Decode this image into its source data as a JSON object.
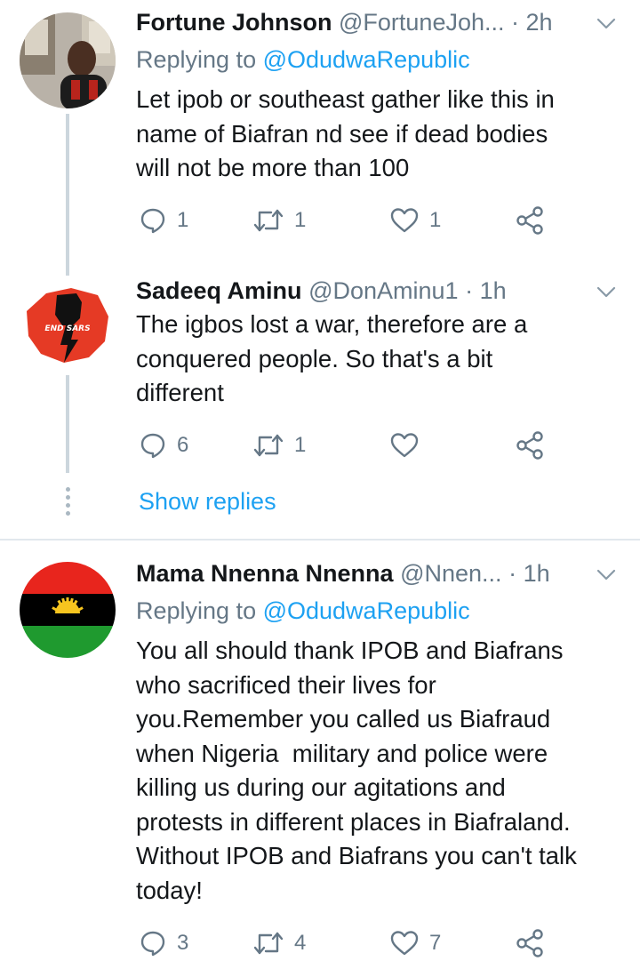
{
  "tweets": [
    {
      "name": "Fortune Johnson",
      "handle": "@FortuneJoh...",
      "dot": "·",
      "time": "2h",
      "replying_prefix": "Replying to ",
      "replying_to": "@OdudwaRepublic",
      "text": "Let ipob or southeast gather like this in\nname of Biafran nd see if dead bodies\nwill not be more than 100",
      "reply_count": "1",
      "retweet_count": "1",
      "like_count": "1",
      "avatar_icon": "person-photo-avatar"
    },
    {
      "name": "Sadeeq Aminu",
      "handle": "@DonAminu1",
      "dot": "·",
      "time": "1h",
      "text": "The igbos lost a war, therefore are a\nconquered people. So that's a bit\ndifferent",
      "reply_count": "6",
      "retweet_count": "1",
      "like_count": "",
      "avatar_text": "END SARS",
      "avatar_icon": "end-sars-fist-avatar"
    },
    {
      "name": "Mama Nnenna Nnenna",
      "handle": "@Nnen...",
      "dot": "·",
      "time": "1h",
      "replying_prefix": "Replying to ",
      "replying_to": "@OdudwaRepublic",
      "text": "You all should thank IPOB and Biafrans\nwho sacrificed their lives for\nyou.Remember you called us Biafraud\nwhen Nigeria  military and police were\nkilling us during our agitations and\nprotests in different places in Biafraland.\nWithout IPOB and Biafrans you can't talk\ntoday!",
      "reply_count": "3",
      "retweet_count": "4",
      "like_count": "7",
      "avatar_icon": "biafra-flag-avatar"
    }
  ],
  "show_replies": "Show replies",
  "colors": {
    "accent": "#1da1f2",
    "secondary_text": "#657786",
    "primary_text": "#14171a",
    "thread_line": "#ccd6dd",
    "divider": "#e1e8ed"
  },
  "icons": {
    "reply": "reply-icon",
    "retweet": "retweet-icon",
    "like": "heart-icon",
    "share": "share-icon",
    "menu": "chevron-down-icon"
  }
}
